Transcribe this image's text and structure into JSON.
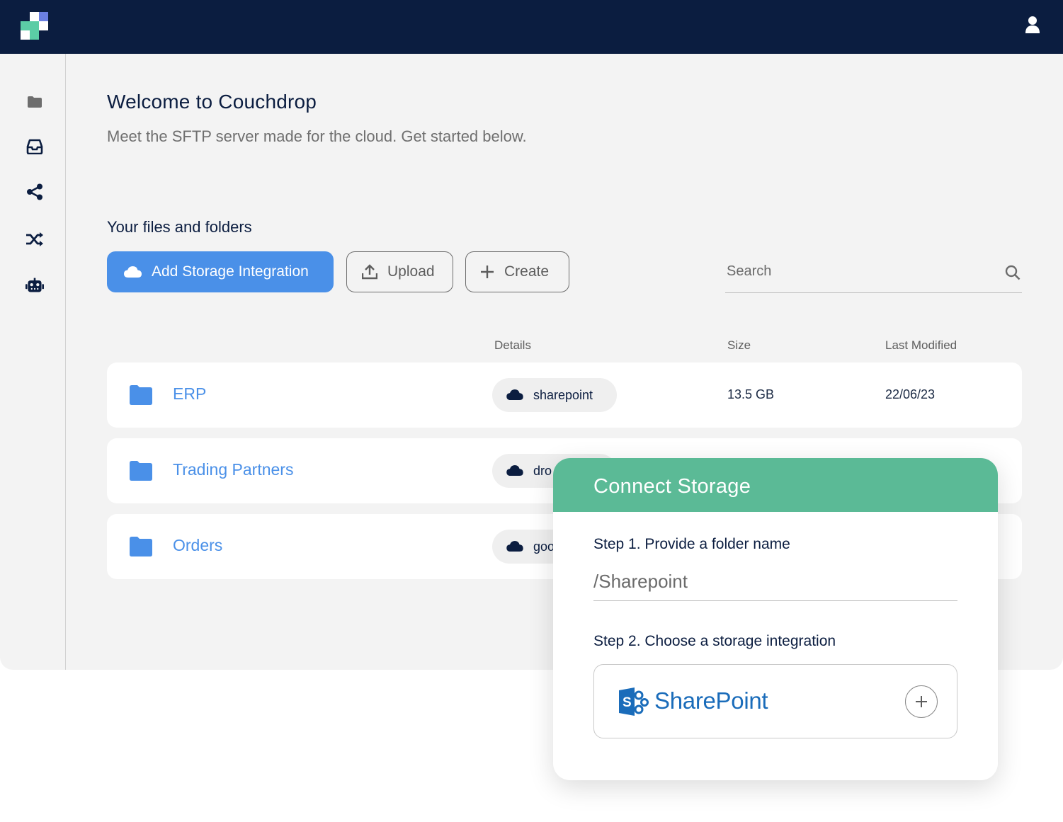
{
  "header": {
    "logo_icon": "couchdrop-logo",
    "user_icon": "user-icon"
  },
  "sidebar": {
    "items": [
      {
        "name": "files",
        "icon": "folder-icon"
      },
      {
        "name": "inbox",
        "icon": "inbox-icon"
      },
      {
        "name": "shares",
        "icon": "share-icon"
      },
      {
        "name": "automations",
        "icon": "shuffle-icon"
      },
      {
        "name": "bots",
        "icon": "robot-icon"
      }
    ]
  },
  "main": {
    "title": "Welcome to Couchdrop",
    "subtitle": "Meet the SFTP server made for the cloud. Get started below.",
    "section_title": "Your files and folders",
    "buttons": {
      "add_storage": "Add Storage Integration",
      "upload": "Upload",
      "create": "Create"
    },
    "search": {
      "placeholder": "Search"
    },
    "columns": {
      "details": "Details",
      "size": "Size",
      "last_modified": "Last Modified"
    },
    "rows": [
      {
        "name": "ERP",
        "details": "sharepoint",
        "size": "13.5 GB",
        "modified": "22/06/23"
      },
      {
        "name": "Trading Partners",
        "details": "dro",
        "size": "",
        "modified": ""
      },
      {
        "name": "Orders",
        "details": "goo",
        "size": "",
        "modified": ""
      }
    ]
  },
  "modal": {
    "title": "Connect Storage",
    "step1_label": "Step 1. Provide a folder name",
    "folder_value": "/Sharepoint",
    "step2_label": "Step 2. Choose a storage integration",
    "integration_name": "SharePoint"
  },
  "colors": {
    "topbar": "#0b1d40",
    "primary": "#4a90e8",
    "modal_header": "#5bba96",
    "sharepoint": "#1a6cba"
  }
}
